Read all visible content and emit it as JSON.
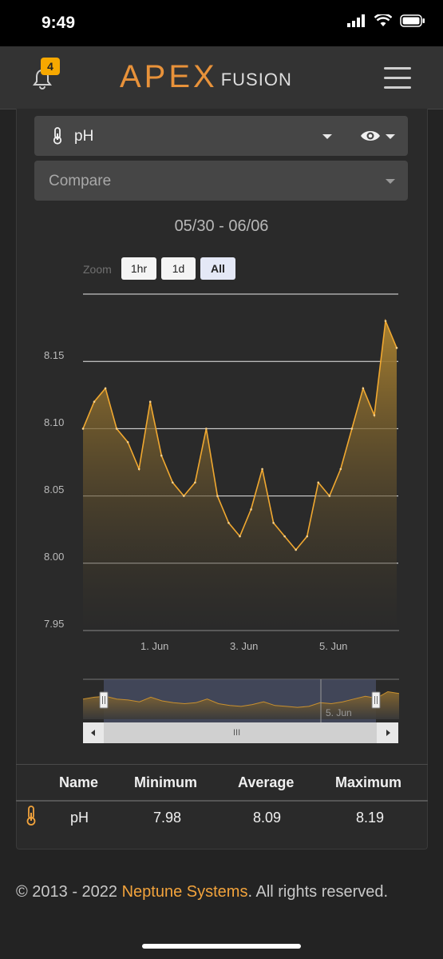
{
  "status": {
    "time": "9:49"
  },
  "header": {
    "notification_count": "4",
    "logo_main": "APEX",
    "logo_sub": "FUSION"
  },
  "controls": {
    "probe_select": "pH",
    "compare_placeholder": "Compare",
    "date_range": "05/30 - 06/06",
    "zoom_label": "Zoom",
    "zoom_options": [
      "1hr",
      "1d",
      "All"
    ],
    "zoom_selected": "All"
  },
  "chart_data": {
    "type": "area",
    "series_name": "pH",
    "color": "#f0a830",
    "ylim": [
      7.95,
      8.2
    ],
    "y_ticks": [
      "8.15",
      "8.10",
      "8.05",
      "8.00",
      "7.95"
    ],
    "x_ticks": [
      "1. Jun",
      "3. Jun",
      "5. Jun"
    ],
    "navigator_label": "5. Jun",
    "x": [
      "05/30 12:00",
      "05/30 18:00",
      "05/31 00:00",
      "05/31 06:00",
      "05/31 12:00",
      "05/31 18:00",
      "06/01 00:00",
      "06/01 06:00",
      "06/01 12:00",
      "06/01 18:00",
      "06/02 00:00",
      "06/02 06:00",
      "06/02 12:00",
      "06/02 18:00",
      "06/03 00:00",
      "06/03 06:00",
      "06/03 12:00",
      "06/03 18:00",
      "06/04 00:00",
      "06/04 06:00",
      "06/04 12:00",
      "06/04 18:00",
      "06/05 00:00",
      "06/05 06:00",
      "06/05 12:00",
      "06/05 18:00",
      "06/06 00:00",
      "06/06 06:00",
      "06/06 12:00"
    ],
    "values": [
      8.1,
      8.12,
      8.13,
      8.1,
      8.09,
      8.07,
      8.12,
      8.08,
      8.06,
      8.05,
      8.06,
      8.1,
      8.05,
      8.03,
      8.02,
      8.04,
      8.07,
      8.03,
      8.02,
      8.01,
      8.02,
      8.06,
      8.05,
      8.07,
      8.1,
      8.13,
      8.11,
      8.18,
      8.16
    ]
  },
  "stats": {
    "headers": [
      "Name",
      "Minimum",
      "Average",
      "Maximum"
    ],
    "row": {
      "name": "pH",
      "minimum": "7.98",
      "average": "8.09",
      "maximum": "8.19"
    }
  },
  "footer": {
    "prefix": "© 2013 - 2022 ",
    "company": "Neptune Systems",
    "suffix": ". All rights reserved."
  },
  "colors": {
    "accent": "#f0a830",
    "background": "#232323",
    "header": "#333333"
  }
}
